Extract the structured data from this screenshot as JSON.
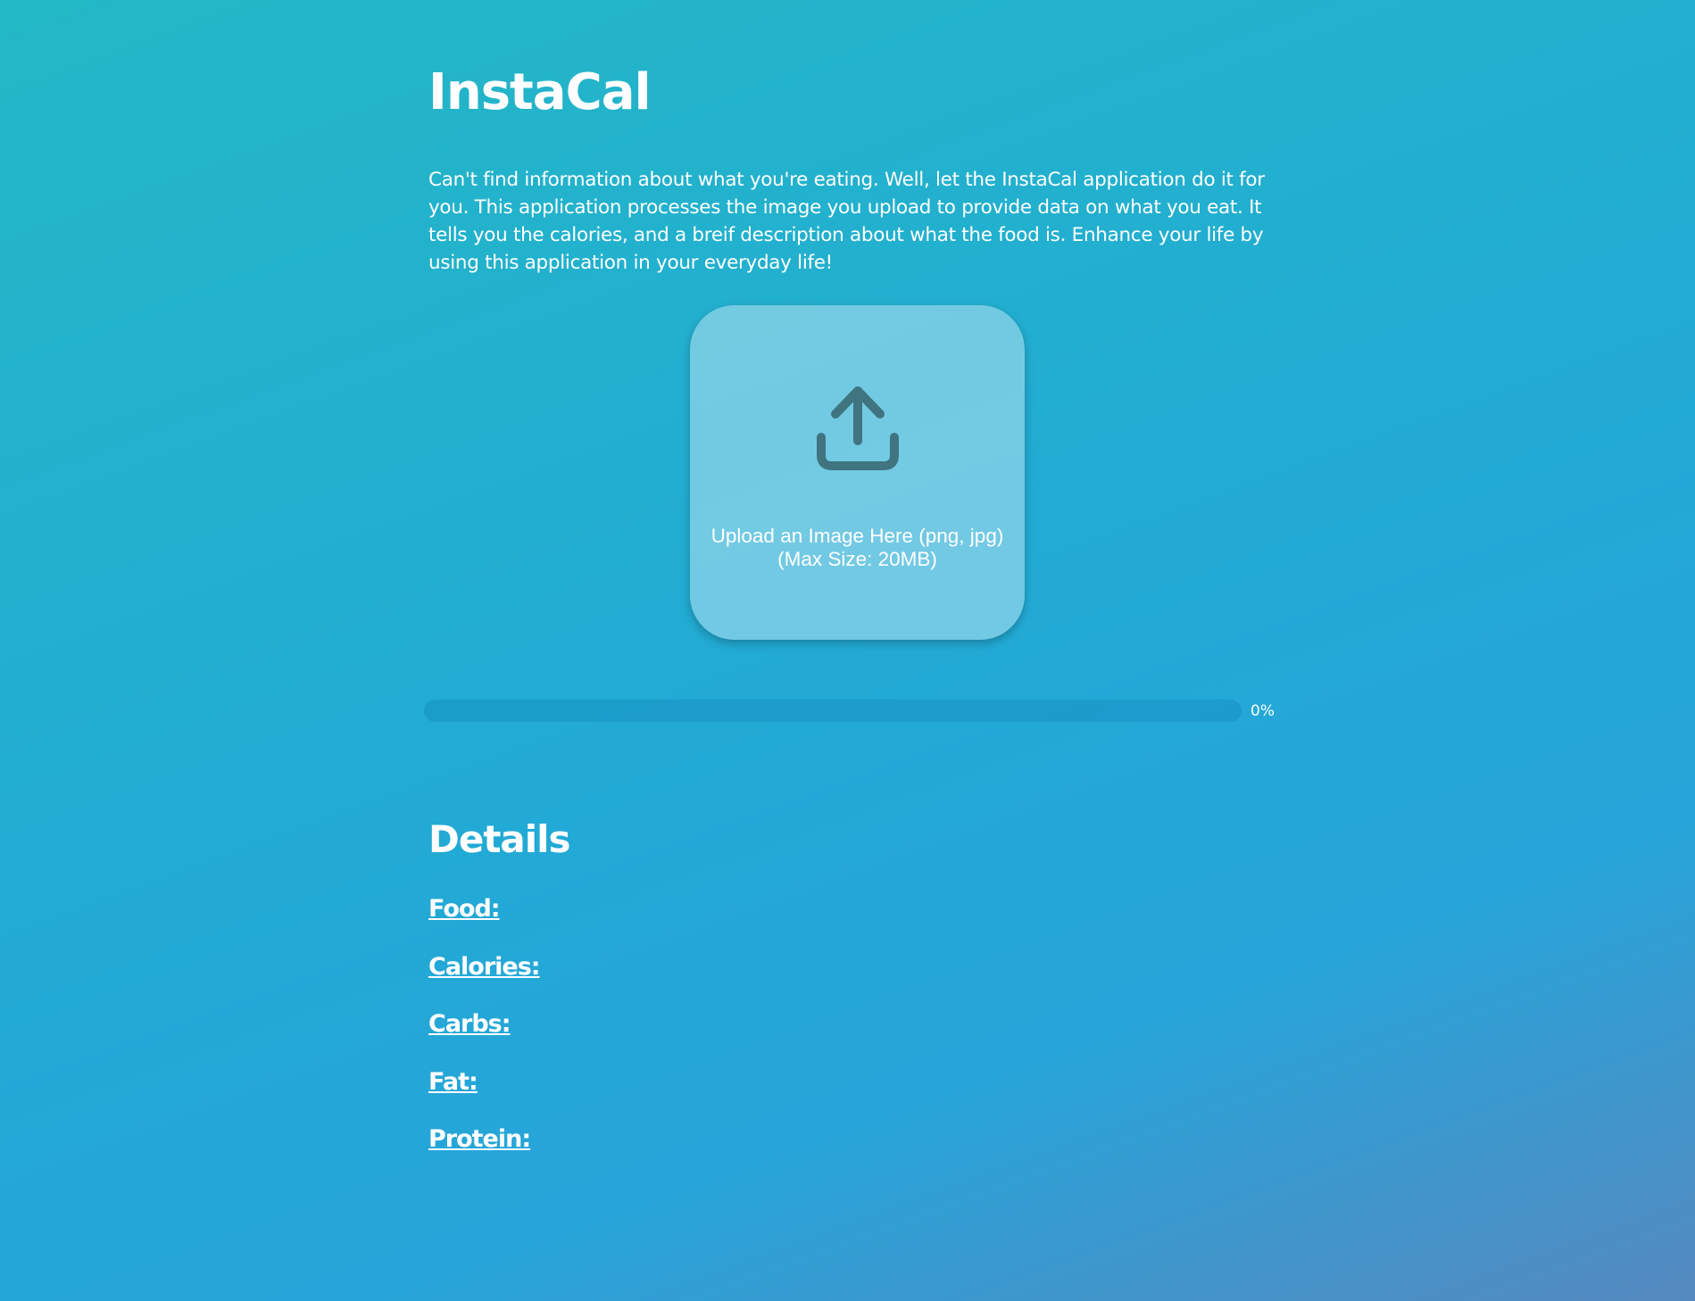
{
  "app": {
    "title": "InstaCal"
  },
  "intro": {
    "text": "Can't find information about what you're eating. Well, let the InstaCal application do it for you. This application processes the image you upload to provide data on what you eat. It tells you the calories, and a breif description about what the food is. Enhance your life by using this application in your everyday life!"
  },
  "upload": {
    "icon": "upload-icon",
    "line1": "Upload an Image Here (png, jpg)",
    "line2": "(Max Size: 20MB)"
  },
  "progress": {
    "value_percent": 0,
    "label": "0%"
  },
  "details": {
    "heading": "Details",
    "food_label": "Food:",
    "calories_label": "Calories:",
    "carbs_label": "Carbs:",
    "fat_label": "Fat:",
    "protein_label": "Protein:"
  },
  "colors": {
    "background_start": "#23b8c6",
    "background_end": "#5589bf",
    "icon": "#3f7480",
    "text": "#ffffff"
  }
}
